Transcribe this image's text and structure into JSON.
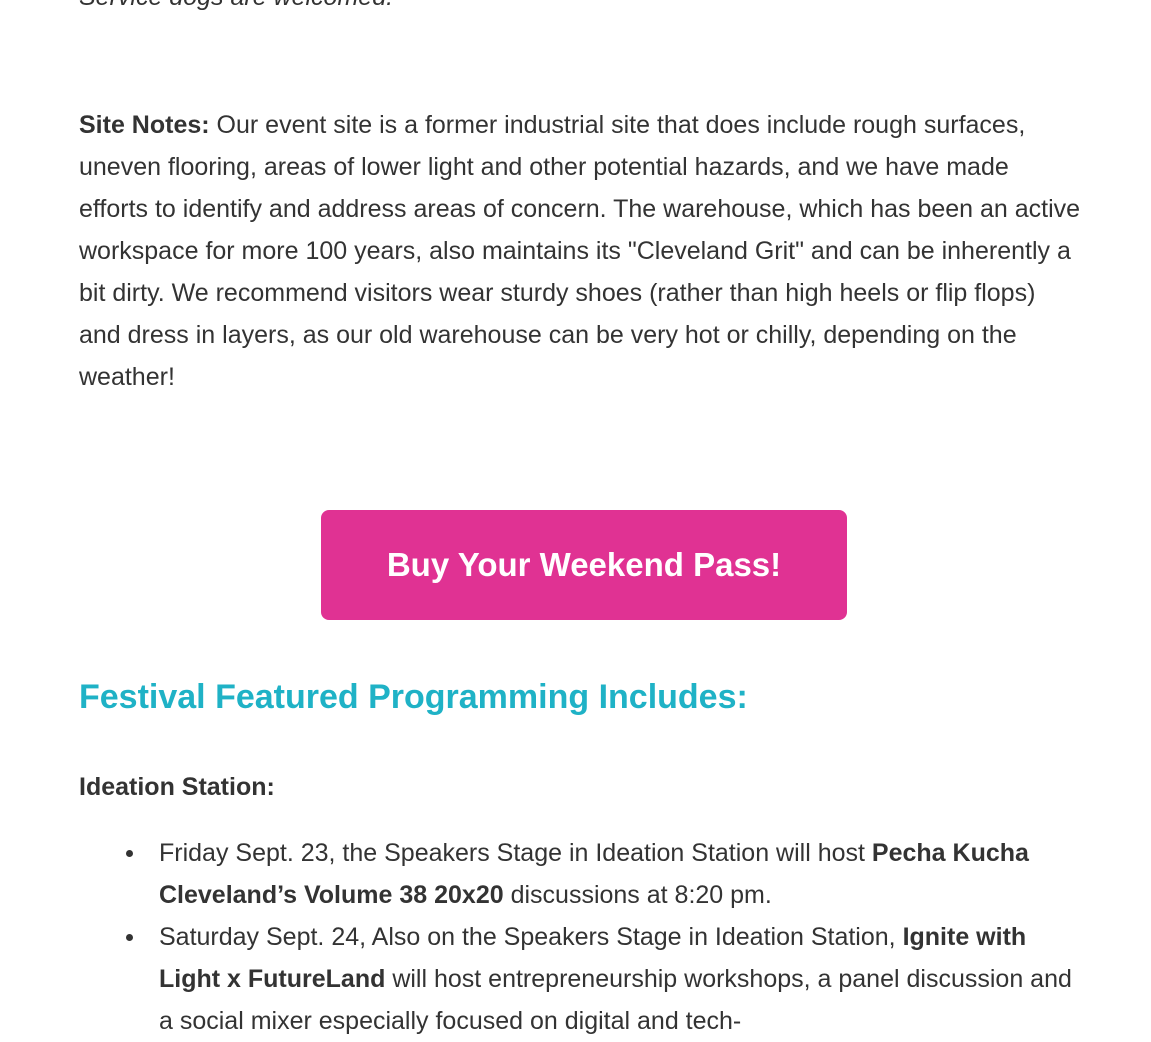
{
  "top_note": "Service dogs are welcomed.",
  "site_notes": {
    "label": "Site Notes:",
    "text": " Our event site is a former industrial site that does include rough surfaces, uneven flooring, areas of lower light and other potential hazards, and we have made efforts to identify and address areas of concern. The warehouse, which has been an active workspace for more 100 years, also maintains its \"Cleveland Grit\" and can be inherently a bit dirty. We recommend visitors wear sturdy shoes (rather than high heels or flip flops) and dress in layers, as our old warehouse can be very hot or chilly, depending on the weather!"
  },
  "cta": {
    "label": "Buy Your Weekend Pass!",
    "color": "#e03293"
  },
  "section": {
    "title": "Festival Featured Programming Includes:",
    "color": "#1fb2c6"
  },
  "ideation": {
    "title": "Ideation Station:",
    "items": [
      {
        "before": "Friday Sept. 23, the Speakers Stage in Ideation Station will host ",
        "bold": "Pecha Kucha Cleveland’s Volume 38 20x20",
        "after": " discussions at 8:20 pm."
      },
      {
        "before": "Saturday Sept. 24, Also on the Speakers Stage in Ideation Station, ",
        "bold": "Ignite with Light x FutureLand",
        "after": " will host entrepreneurship workshops, a panel discussion and a social mixer especially focused on digital and tech-"
      }
    ]
  }
}
